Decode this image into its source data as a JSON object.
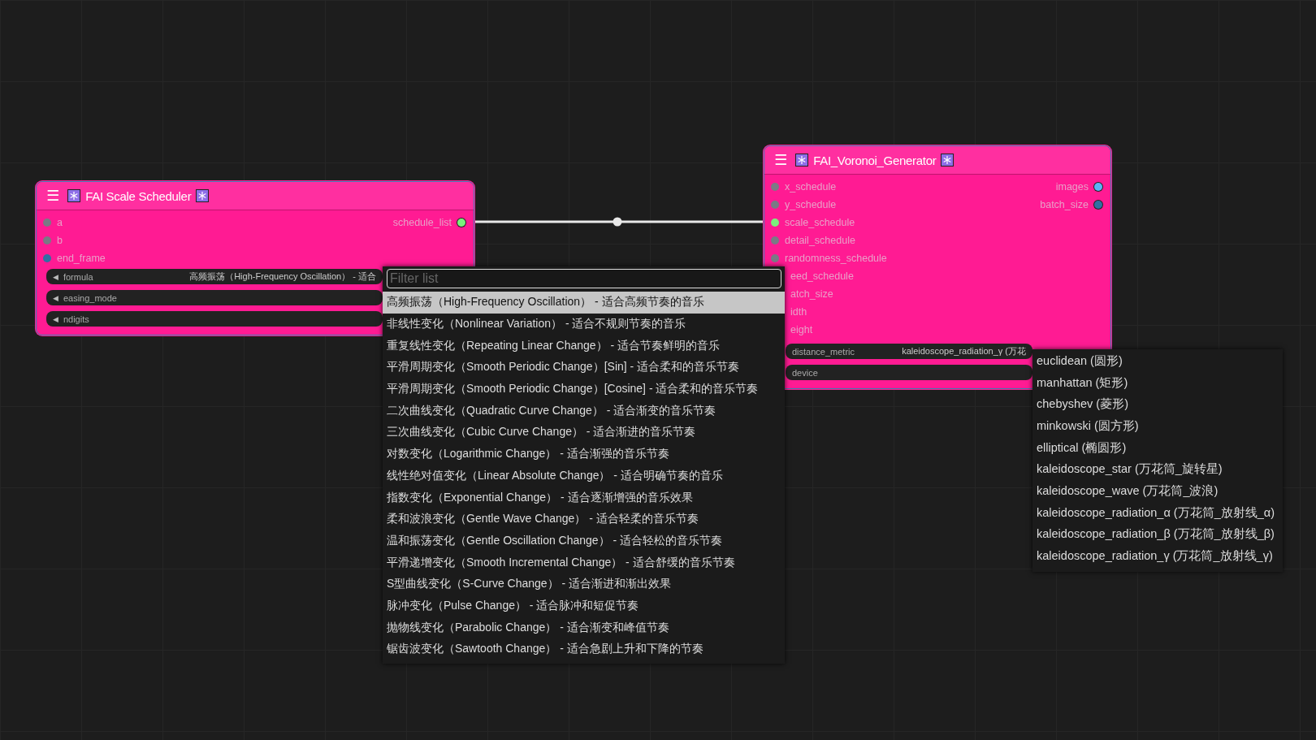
{
  "nodes": [
    {
      "title": "FAI Scale Scheduler",
      "menu_icon": "☰",
      "inputs": [
        {
          "label": "a",
          "color": "#7a7a85"
        },
        {
          "label": "b",
          "color": "#7a7a85"
        },
        {
          "label": "end_frame",
          "color": "#2f6fa3"
        }
      ],
      "outputs": [
        {
          "label": "schedule_list",
          "color": "#7cf07c"
        }
      ],
      "widgets": [
        {
          "arrow": "◀",
          "label": "formula",
          "value": "高频振荡（High-Frequency Oscillation） - 适合"
        },
        {
          "arrow": "◀",
          "label": "easing_mode"
        },
        {
          "arrow": "◀",
          "label": "ndigits"
        }
      ]
    },
    {
      "title": "FAI_Voronoi_Generator",
      "menu_icon": "☰",
      "inputs": [
        {
          "label": "x_schedule",
          "color": "#7a7a85"
        },
        {
          "label": "y_schedule",
          "color": "#7a7a85"
        },
        {
          "label": "scale_schedule",
          "color": "#7cf07c"
        },
        {
          "label": "detail_schedule",
          "color": "#7a7a85"
        },
        {
          "label": "randomness_schedule",
          "color": "#7a7a85"
        },
        {
          "label": "eed_schedule"
        },
        {
          "label": "atch_size"
        },
        {
          "label": "idth"
        },
        {
          "label": "eight"
        }
      ],
      "outputs": [
        {
          "label": "images",
          "color": "#5ab4f5"
        },
        {
          "label": "batch_size",
          "color": "#2f6fa3"
        }
      ],
      "widgets": [
        {
          "label": "distance_metric",
          "value": "kaleidoscope_radiation_γ (万花"
        },
        {
          "label": "device"
        }
      ]
    }
  ],
  "formula_dropdown": {
    "placeholder": "Filter list",
    "items": [
      {
        "label": "高频振荡（High-Frequency Oscillation） - 适合高频节奏的音乐",
        "selected": true
      },
      {
        "label": "非线性变化（Nonlinear Variation） - 适合不规则节奏的音乐",
        "selected": false
      },
      {
        "label": "重复线性变化（Repeating Linear Change） - 适合节奏鲜明的音乐",
        "selected": false
      },
      {
        "label": "平滑周期变化（Smooth Periodic Change）[Sin] - 适合柔和的音乐节奏",
        "selected": false
      },
      {
        "label": "平滑周期变化（Smooth Periodic Change）[Cosine] - 适合柔和的音乐节奏",
        "selected": false
      },
      {
        "label": "二次曲线变化（Quadratic Curve Change） - 适合渐变的音乐节奏",
        "selected": false
      },
      {
        "label": "三次曲线变化（Cubic Curve Change） - 适合渐进的音乐节奏",
        "selected": false
      },
      {
        "label": "对数变化（Logarithmic Change） - 适合渐强的音乐节奏",
        "selected": false
      },
      {
        "label": "线性绝对值变化（Linear Absolute Change） - 适合明确节奏的音乐",
        "selected": false
      },
      {
        "label": "指数变化（Exponential Change） - 适合逐渐增强的音乐效果",
        "selected": false
      },
      {
        "label": "柔和波浪变化（Gentle Wave Change） - 适合轻柔的音乐节奏",
        "selected": false
      },
      {
        "label": "温和振荡变化（Gentle Oscillation Change） - 适合轻松的音乐节奏",
        "selected": false
      },
      {
        "label": "平滑递增变化（Smooth Incremental Change） - 适合舒缓的音乐节奏",
        "selected": false
      },
      {
        "label": "S型曲线变化（S-Curve Change） - 适合渐进和渐出效果",
        "selected": false
      },
      {
        "label": "脉冲变化（Pulse Change） - 适合脉冲和短促节奏",
        "selected": false
      },
      {
        "label": "抛物线变化（Parabolic Change） - 适合渐变和峰值节奏",
        "selected": false
      },
      {
        "label": "锯齿波变化（Sawtooth Change） - 适合急剧上升和下降的节奏",
        "selected": false
      }
    ]
  },
  "distance_menu": {
    "items": [
      {
        "label": "euclidean (圆形)",
        "selected": false
      },
      {
        "label": "manhattan (矩形)",
        "selected": false
      },
      {
        "label": "chebyshev (菱形)",
        "selected": false
      },
      {
        "label": "minkowski (圆方形)",
        "selected": false
      },
      {
        "label": "elliptical (椭圆形)",
        "selected": false
      },
      {
        "label": "kaleidoscope_star (万花筒_旋转星)",
        "selected": false
      },
      {
        "label": "kaleidoscope_wave (万花筒_波浪)",
        "selected": false
      },
      {
        "label": "kaleidoscope_radiation_α (万花筒_放射线_α)",
        "selected": false
      },
      {
        "label": "kaleidoscope_radiation_β (万花筒_放射线_β)",
        "selected": false
      },
      {
        "label": "kaleidoscope_radiation_γ (万花筒_放射线_γ)",
        "selected": false
      }
    ]
  }
}
